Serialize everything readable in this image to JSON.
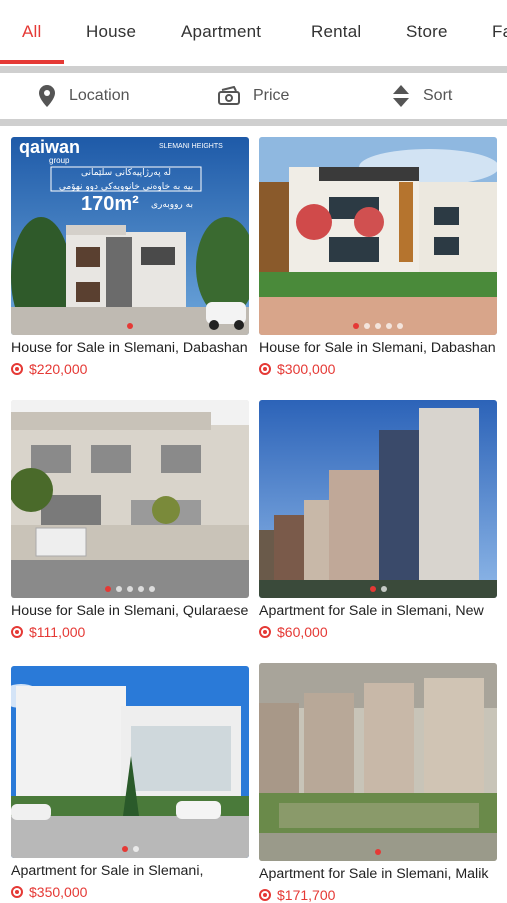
{
  "tabs": [
    {
      "label": "All",
      "active": true
    },
    {
      "label": "House"
    },
    {
      "label": "Apartment"
    },
    {
      "label": "Rental"
    },
    {
      "label": "Store"
    },
    {
      "label": "Fa"
    }
  ],
  "filters": {
    "location": {
      "label": "Location",
      "icon": "location-pin-icon"
    },
    "price": {
      "label": "Price",
      "icon": "money-icon"
    },
    "sort": {
      "label": "Sort",
      "icon": "sort-icon"
    }
  },
  "accent_color": "#e53935",
  "ad_banner": {
    "brand": "qaiwan",
    "brand_sub": "group",
    "partner": "SLEMANI HEIGHTS",
    "line1": "لە پەرژاپیەکانی سلێمانی",
    "line2": "بیە بە خاوەنی خانوویەکی دوو نهۆمی",
    "area": "170m²",
    "line3": "بە رووبەری"
  },
  "listings": [
    {
      "title": "House for Sale in Slemani, Dabashan",
      "price": "$220,000",
      "dots": 1,
      "active_dot": 0
    },
    {
      "title": "House for Sale in Slemani, Dabashan",
      "price": "$300,000",
      "dots": 5,
      "active_dot": 0
    },
    {
      "title": "House for Sale in Slemani, Qularaese",
      "price": "$111,000",
      "dots": 5,
      "active_dot": 0
    },
    {
      "title": "Apartment for Sale in Slemani, New",
      "price": "$60,000",
      "dots": 2,
      "active_dot": 0
    },
    {
      "title": "Apartment for Sale in Slemani,",
      "price": "$350,000",
      "dots": 2,
      "active_dot": 0
    },
    {
      "title": "Apartment for Sale in Slemani, Malik",
      "price": "$171,700",
      "dots": 1,
      "active_dot": 0
    }
  ]
}
